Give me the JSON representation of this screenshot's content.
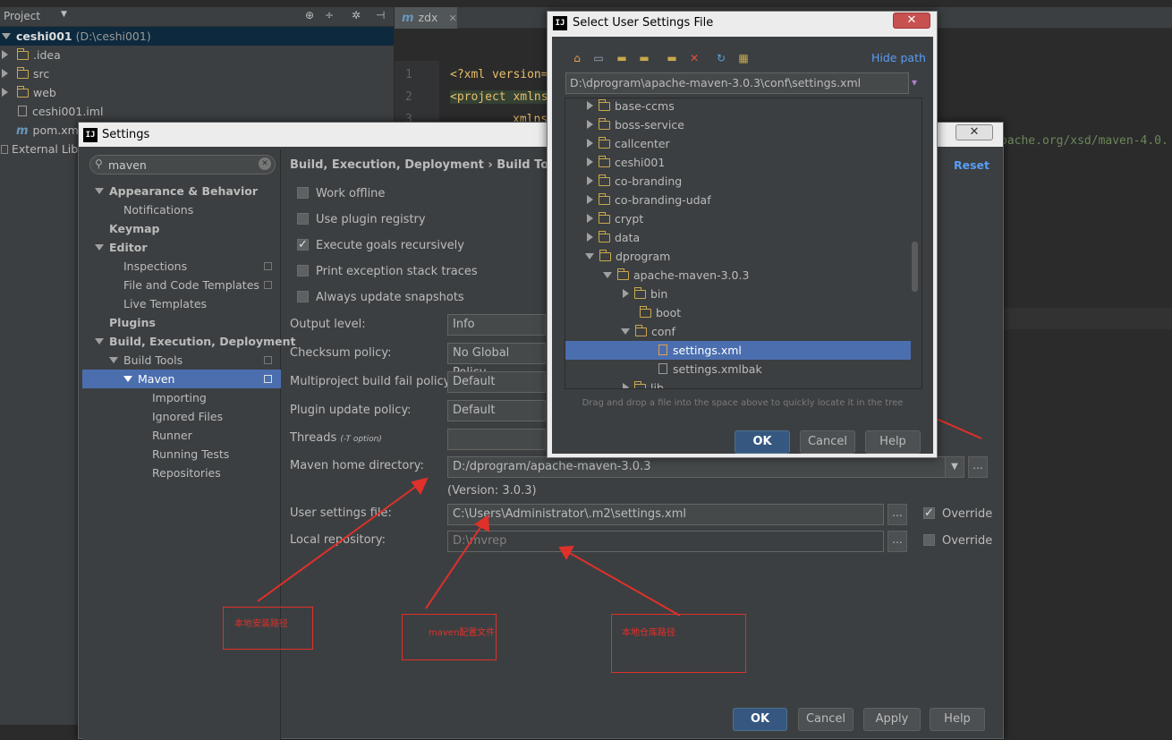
{
  "project_panel": {
    "header": "Project",
    "tree": [
      {
        "label": "ceshi001",
        "suffix": " (D:\\ceshi001)"
      },
      {
        "label": ".idea"
      },
      {
        "label": "src"
      },
      {
        "label": "web"
      },
      {
        "label": "ceshi001.iml"
      },
      {
        "label": "pom.xml"
      },
      {
        "label": "External Librarie"
      }
    ]
  },
  "editor": {
    "tab_label": "zdx",
    "line_numbers": [
      "1",
      "2",
      "3"
    ],
    "lines": [
      "<?xml version=",
      "<project xmlns",
      "xmlns"
    ],
    "right_snippet": "pache.org/xsd/maven-4.0."
  },
  "settings": {
    "title": "Settings",
    "search_value": "maven",
    "nav": [
      {
        "label": "Appearance & Behavior",
        "bold": true
      },
      {
        "label": "Notifications"
      },
      {
        "label": "Keymap",
        "bold": true
      },
      {
        "label": "Editor",
        "bold": true
      },
      {
        "label": "Inspections"
      },
      {
        "label": "File and Code Templates"
      },
      {
        "label": "Live Templates"
      },
      {
        "label": "Plugins",
        "bold": true
      },
      {
        "label": "Build, Execution, Deployment",
        "bold": true
      },
      {
        "label": "Build Tools"
      },
      {
        "label": "Maven"
      },
      {
        "label": "Importing"
      },
      {
        "label": "Ignored Files"
      },
      {
        "label": "Runner"
      },
      {
        "label": "Running Tests"
      },
      {
        "label": "Repositories"
      }
    ],
    "breadcrumb": "Build, Execution, Deployment › Build Tools › M",
    "reset_label": "Reset",
    "checkboxes": [
      {
        "label": "Work offline",
        "checked": false
      },
      {
        "label": "Use plugin registry",
        "checked": false
      },
      {
        "label": "Execute goals recursively",
        "checked": true
      },
      {
        "label": "Print exception stack traces",
        "checked": false
      },
      {
        "label": "Always update snapshots",
        "checked": false
      }
    ],
    "output_level_label": "Output level:",
    "output_level_value": "Info",
    "checksum_label": "Checksum policy:",
    "checksum_value": "No Global Policy",
    "multiproject_label": "Multiproject build fail policy:",
    "multiproject_value": "Default",
    "plugin_update_label": "Plugin update policy:",
    "plugin_update_value": "Default",
    "threads_label": "Threads",
    "threads_hint": "(-T option)",
    "threads_value": "",
    "maven_home_label": "Maven home directory:",
    "maven_home_value": "D:/dprogram/apache-maven-3.0.3",
    "version_text": "(Version: 3.0.3)",
    "user_settings_label": "User settings file:",
    "user_settings_value": "C:\\Users\\Administrator\\.m2\\settings.xml",
    "user_settings_override": "Override",
    "local_repo_label": "Local repository:",
    "local_repo_value": "D:\\mvrep",
    "local_repo_override": "Override",
    "ellipsis": "...",
    "buttons": {
      "ok": "OK",
      "cancel": "Cancel",
      "apply": "Apply",
      "help": "Help"
    }
  },
  "chooser": {
    "title": "Select User Settings File",
    "hide_path": "Hide path",
    "path_value": "D:\\dprogram\\apache-maven-3.0.3\\conf\\settings.xml",
    "tree": [
      {
        "label": "base-ccms"
      },
      {
        "label": "boss-service"
      },
      {
        "label": "callcenter"
      },
      {
        "label": "ceshi001"
      },
      {
        "label": "co-branding"
      },
      {
        "label": "co-branding-udaf"
      },
      {
        "label": "crypt"
      },
      {
        "label": "data"
      },
      {
        "label": "dprogram"
      },
      {
        "label": "apache-maven-3.0.3"
      },
      {
        "label": "bin"
      },
      {
        "label": "boot"
      },
      {
        "label": "conf"
      },
      {
        "label": "settings.xml"
      },
      {
        "label": "settings.xmlbak"
      },
      {
        "label": "lib"
      }
    ],
    "drag_hint": "Drag and drop a file into the space above to quickly locate it in the tree",
    "buttons": {
      "ok": "OK",
      "cancel": "Cancel",
      "help": "Help"
    }
  },
  "annotations": [
    {
      "text": "本地安装路径"
    },
    {
      "text": "maven配置文件"
    },
    {
      "text": "本地仓库路径"
    }
  ],
  "colors": {
    "accent": "#4b6eaf",
    "annotation": "#e0302a",
    "link": "#589df6"
  }
}
